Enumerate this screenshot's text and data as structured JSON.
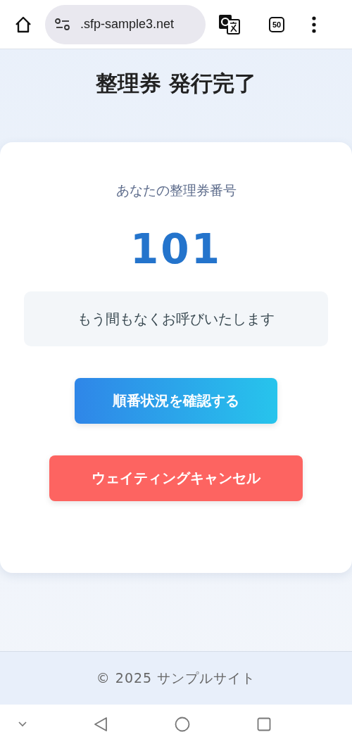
{
  "browser": {
    "url": ".sfp-sample3.net",
    "tab_count": "50"
  },
  "page": {
    "title": "整理券 発行完了"
  },
  "card": {
    "label": "あなたの整理券番号",
    "number": "101",
    "message": "もう間もなくお呼びいたします",
    "buttons": [
      {
        "kind": "primary",
        "label": "順番状況を確認する"
      },
      {
        "kind": "danger",
        "label": "ウェイティングキャンセル"
      }
    ]
  },
  "footer": {
    "text": "© 2025 サンプルサイト"
  }
}
